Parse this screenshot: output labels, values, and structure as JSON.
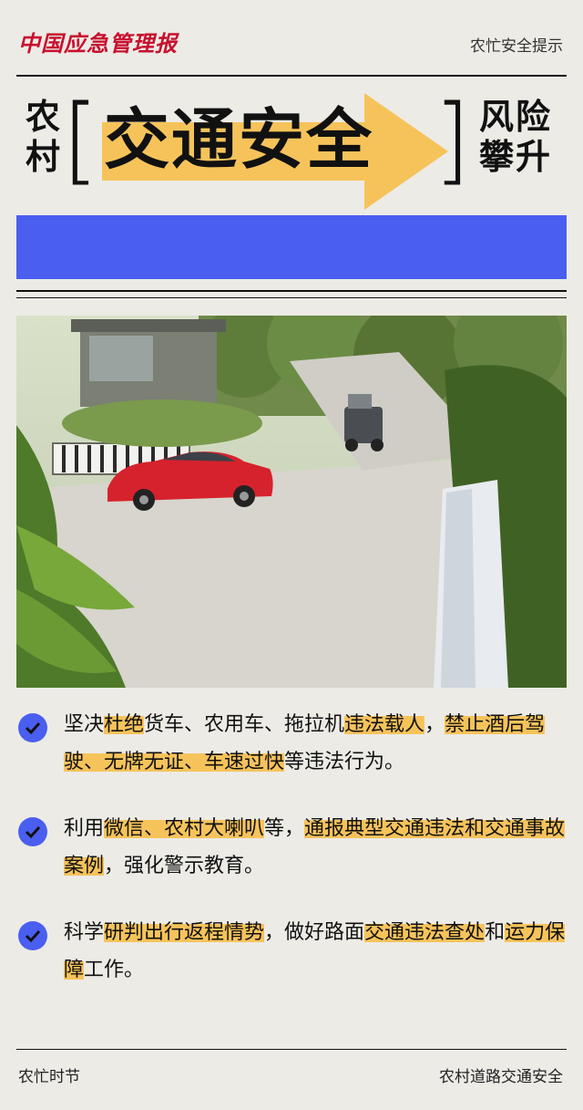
{
  "header": {
    "logo_text": "中国应急管理报",
    "topic": "农忙安全提示"
  },
  "title": {
    "left": "农村",
    "bracket_open": "[",
    "main": "交通安全",
    "bracket_close": "]",
    "right": "风险攀升"
  },
  "bullets": [
    {
      "segments": [
        {
          "text": "坚决",
          "hl": false
        },
        {
          "text": "杜绝",
          "hl": true
        },
        {
          "text": "货车、农用车、拖拉机",
          "hl": false
        },
        {
          "text": "违法载人",
          "hl": true
        },
        {
          "text": "，",
          "hl": false
        },
        {
          "text": "禁止酒后驾驶、无牌无证、车速过快",
          "hl": true
        },
        {
          "text": "等违法行为。",
          "hl": false
        }
      ]
    },
    {
      "segments": [
        {
          "text": "利用",
          "hl": false
        },
        {
          "text": "微信、农村大喇叭",
          "hl": true
        },
        {
          "text": "等，",
          "hl": false
        },
        {
          "text": "通报典型交通违法和交通事故案例",
          "hl": true
        },
        {
          "text": "，强化警示教育。",
          "hl": false
        }
      ]
    },
    {
      "segments": [
        {
          "text": "科学",
          "hl": false
        },
        {
          "text": "研判出行返程情势",
          "hl": true
        },
        {
          "text": "，做好路面",
          "hl": false
        },
        {
          "text": "交通违法查处",
          "hl": true
        },
        {
          "text": "和",
          "hl": false
        },
        {
          "text": "运力保障",
          "hl": true
        },
        {
          "text": "工作。",
          "hl": false
        }
      ]
    }
  ],
  "footer": {
    "left": "农忙时节",
    "right": "农村道路交通安全"
  },
  "colors": {
    "accent_blue": "#4a5ef0",
    "highlight": "#f6c35b",
    "logo_red": "#c8102e",
    "background": "#ecebe6"
  },
  "icons": {
    "bullet": "check-circle-icon",
    "title_decoration": "arrow-icon"
  }
}
